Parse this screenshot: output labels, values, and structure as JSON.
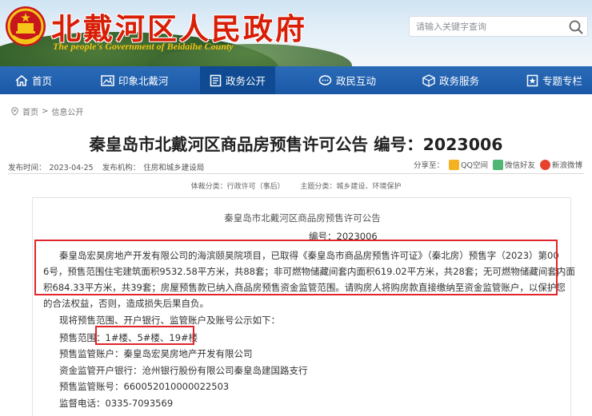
{
  "header": {
    "site_title": "北戴河区人民政府",
    "site_subtitle": "The people's Government of Beidaihe County",
    "search_placeholder": "请输入关键字查询"
  },
  "nav": [
    {
      "label": "首页",
      "icon": "home-icon"
    },
    {
      "label": "印象北戴河",
      "icon": "image-icon"
    },
    {
      "label": "政务公开",
      "icon": "document-icon",
      "active": true
    },
    {
      "label": "政民互动",
      "icon": "chat-icon"
    },
    {
      "label": "政务服务",
      "icon": "service-icon"
    },
    {
      "label": "专题专栏",
      "icon": "column-icon"
    }
  ],
  "breadcrumb": [
    "首页",
    "信息公开"
  ],
  "article": {
    "title": "秦皇岛市北戴河区商品房预售许可公告 编号：2023006",
    "publish_label": "发布时间：",
    "publish_date": "2023-04-25",
    "org_label": "发布机构：",
    "org": "住房和城乡建设局",
    "share_label": "分享至：",
    "share": [
      "QQ空间",
      "微信好友",
      "新浪微博"
    ],
    "category_label": "体裁分类：",
    "category": "行政许可（事后）",
    "topic_label": "主题分类：",
    "topic": "城乡建设、环境保护"
  },
  "content": {
    "heading": "秦皇岛市北戴河区商品房预售许可公告",
    "number": "编号：2023006",
    "para_lines": [
      "秦皇岛宏昊房地产开发有限公司的海滨颐昊院项目，已取得《秦皇岛市商品房预售许可证》（秦北房）预售字（2023）第00",
      "6号，预售范围住宅建筑面积9532.58平方米，共88套；非可燃物储藏间套内面积619.02平方米，共28套；无可燃物储藏间套内面",
      "积684.33平方米，共39套；房屋预售款已纳入商品房预售资金监管范围。请购房人将购房款直接缴纳至资金监管账户，以保护您",
      "的合法权益，否则，造成损失后果自负。"
    ],
    "intro": "现将预售范围、开户银行、监管账户及账号公示如下：",
    "scope_label": "预售范围：",
    "scope": "1#楼、5#楼、19#楼",
    "account_holder": "预售监管账户：秦皇岛宏昊房地产开发有限公司",
    "bank": "资金监管开户银行：沧州银行股份有限公司秦皇岛建国路支行",
    "account_no": "预售监管账号：660052010000022503",
    "phone": "监督电话：0335-7093569"
  }
}
